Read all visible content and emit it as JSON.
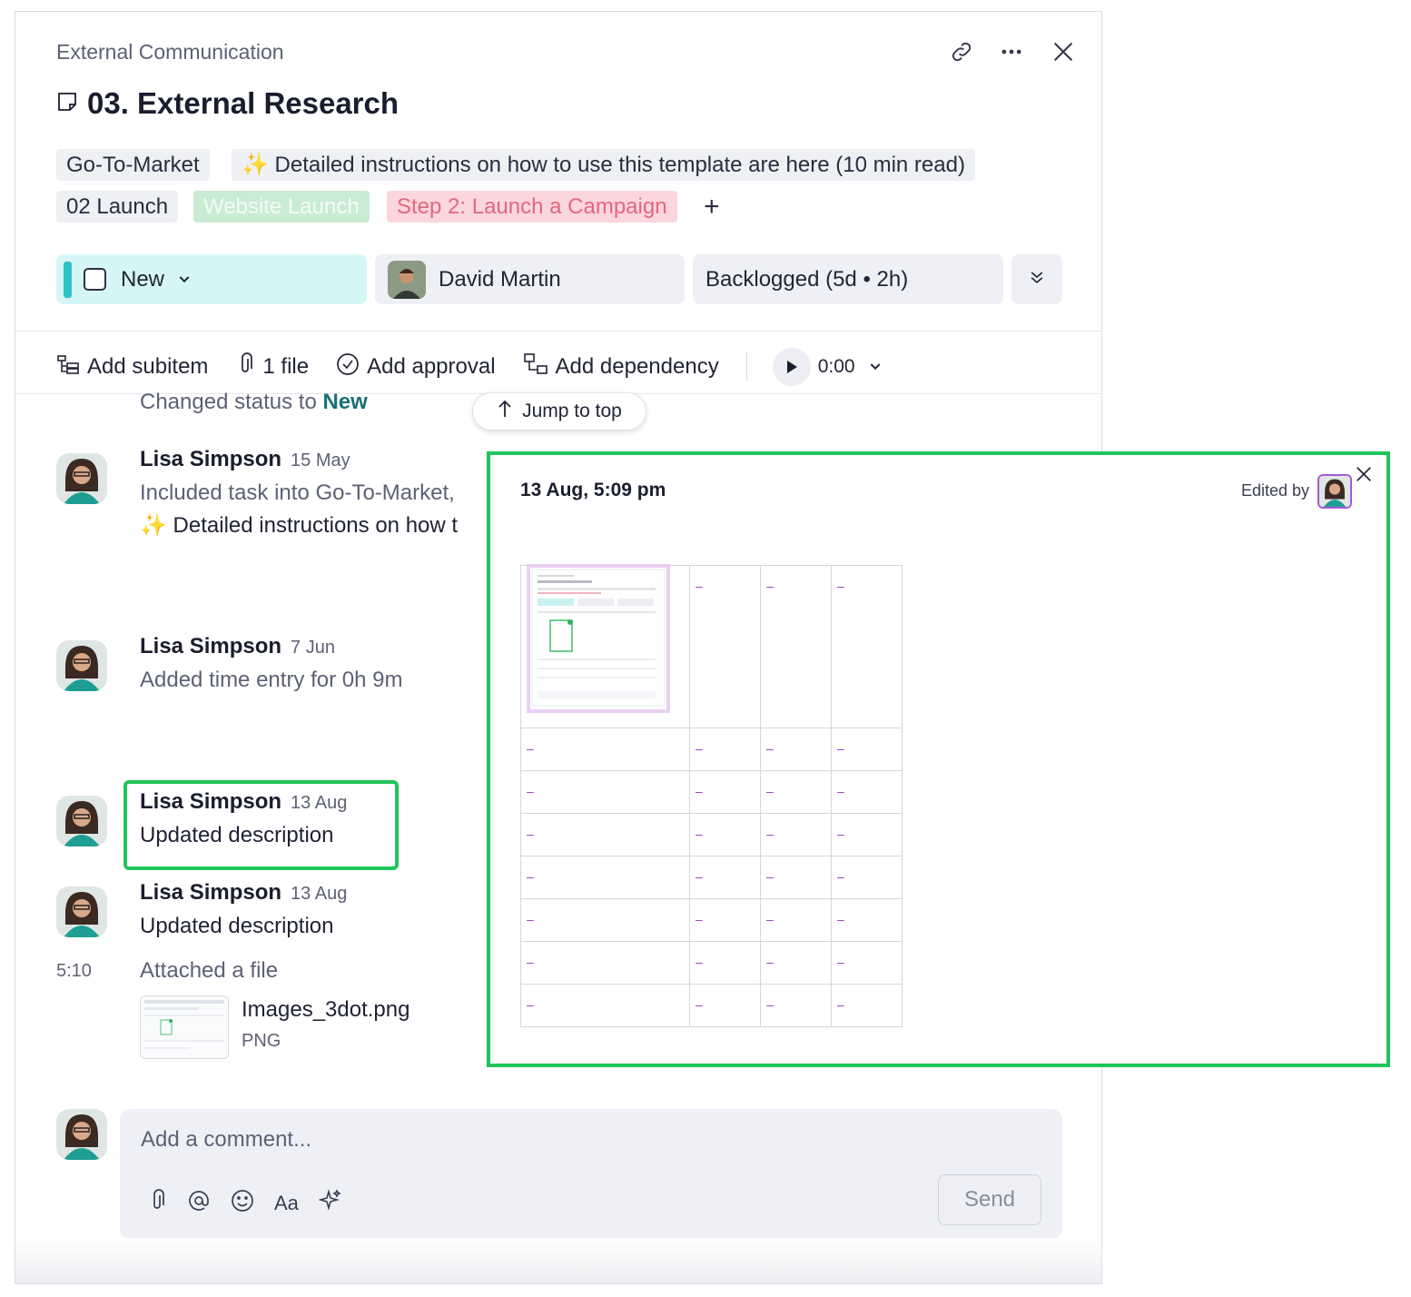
{
  "header": {
    "breadcrumb": "External Communication",
    "title": "03. External Research"
  },
  "tags": {
    "row1": [
      "Go-To-Market",
      "✨ Detailed instructions on how to use this template are here (10 min read)"
    ],
    "row2": [
      "02 Launch",
      "Website Launch",
      "Step 2: Launch a Campaign"
    ],
    "add": "+"
  },
  "fields": {
    "status": "New",
    "assignee": "David Martin",
    "schedule": "Backlogged (5d • 2h)"
  },
  "toolbar": {
    "add_subitem": "Add subitem",
    "files": "1 file",
    "add_approval": "Add approval",
    "add_dependency": "Add dependency",
    "timer": "0:00"
  },
  "jump_to_top": "Jump to top",
  "activity": {
    "status_change_prefix": "Changed status to ",
    "status_change_value": "New",
    "items": [
      {
        "user": "Lisa Simpson",
        "date": "15 May",
        "line1": "Included task into Go-To-Market,",
        "line2": "✨ Detailed instructions on how t"
      },
      {
        "user": "Lisa Simpson",
        "date": "7 Jun",
        "line1": "Added time entry for 0h 9m"
      },
      {
        "user": "Lisa Simpson",
        "date": "13 Aug",
        "line1": "Updated description"
      },
      {
        "user": "Lisa Simpson",
        "date": "13 Aug",
        "line1": "Updated description"
      }
    ],
    "time": "5:10",
    "attached": "Attached a file",
    "file_name": "Images_3dot.png",
    "file_type": "PNG"
  },
  "composer": {
    "placeholder": "Add a comment...",
    "format_label": "Aa",
    "send": "Send"
  },
  "popup": {
    "timestamp": "13 Aug, 5:09 pm",
    "edited_by": "Edited by",
    "cell_mark": "–"
  }
}
